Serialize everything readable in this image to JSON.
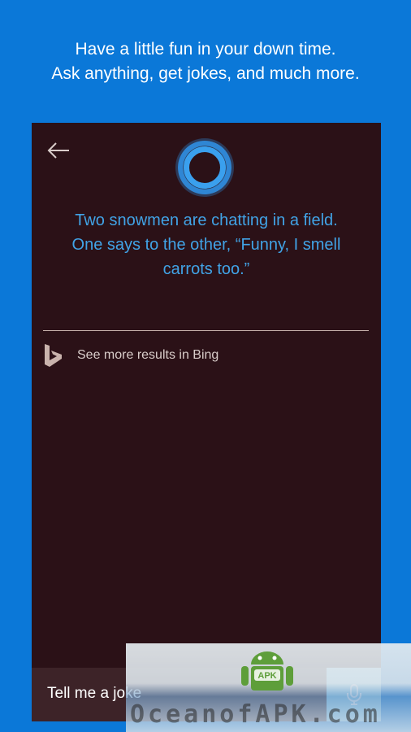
{
  "promo": {
    "line1": "Have a little fun in your down time.",
    "line2": "Ask anything, get jokes, and much more."
  },
  "cortana": {
    "response_line1": "Two snowmen are chatting in a field.",
    "response_line2": "One says to the other, “Funny, I smell",
    "response_line3": "carrots too.”",
    "bing_link": "See more results in Bing",
    "query_text": "Tell me a joke"
  },
  "watermark": {
    "text": "OceanofAPK.com",
    "badge": "APK"
  },
  "colors": {
    "background": "#0b78d8",
    "panel": "#2b1117",
    "accent": "#41a3e6",
    "mic_button": "#8ad2f1"
  },
  "icons": [
    "back-arrow-icon",
    "cortana-icon",
    "bing-icon",
    "microphone-icon",
    "android-icon"
  ]
}
